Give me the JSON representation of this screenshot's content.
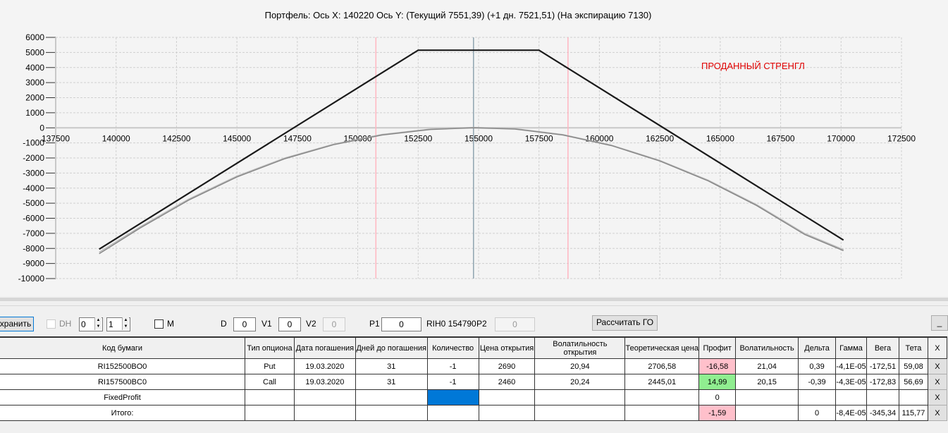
{
  "chart_data": {
    "type": "line",
    "title": "Портфель: Ось X: 140220 Ось Y:  (Текущий 7551,39)  (+1 дн. 7521,51)  (На экспирацию 7130)",
    "annotation": "ПРОДАННЫЙ СТРЕНГЛ",
    "xlim": [
      137500,
      172500
    ],
    "ylim": [
      -10000,
      6000
    ],
    "x_ticks": [
      "137500",
      "140000",
      "142500",
      "145000",
      "147500",
      "150000",
      "152500",
      "155000",
      "157500",
      "160000",
      "162500",
      "165000",
      "167500",
      "170000",
      "172500"
    ],
    "y_ticks": [
      "6000",
      "5000",
      "4000",
      "3000",
      "2000",
      "1000",
      "0",
      "-1000",
      "-2000",
      "-3000",
      "-4000",
      "-5000",
      "-6000",
      "-7000",
      "-8000",
      "-9000",
      "-10000"
    ],
    "vertical_markers": [
      {
        "x": 150750,
        "color": "#ffb6c1"
      },
      {
        "x": 154790,
        "color": "#8fa3b0"
      },
      {
        "x": 158700,
        "color": "#ffb6c1"
      }
    ],
    "series": [
      {
        "name": "На экспирацию",
        "color": "#1a1a1a",
        "points": [
          [
            139300,
            -8050
          ],
          [
            152500,
            5150
          ],
          [
            157500,
            5150
          ],
          [
            170100,
            -7450
          ]
        ]
      },
      {
        "name": "Текущий",
        "color": "#888888",
        "points": [
          [
            139300,
            -8350
          ],
          [
            141000,
            -6640
          ],
          [
            143000,
            -4800
          ],
          [
            145000,
            -3260
          ],
          [
            147000,
            -2040
          ],
          [
            149000,
            -1120
          ],
          [
            151000,
            -480
          ],
          [
            153000,
            -110
          ],
          [
            154800,
            0
          ],
          [
            156500,
            -80
          ],
          [
            158500,
            -480
          ],
          [
            160500,
            -1180
          ],
          [
            162500,
            -2200
          ],
          [
            164500,
            -3520
          ],
          [
            166500,
            -5150
          ],
          [
            168500,
            -7080
          ],
          [
            170100,
            -8150
          ]
        ]
      },
      {
        "name": "+1 дн.",
        "color": "#bbbbbb",
        "points": [
          [
            139300,
            -8250
          ],
          [
            141000,
            -6560
          ],
          [
            143000,
            -4730
          ],
          [
            145000,
            -3200
          ],
          [
            147000,
            -1990
          ],
          [
            149000,
            -1080
          ],
          [
            151000,
            -440
          ],
          [
            153000,
            -80
          ],
          [
            154800,
            30
          ],
          [
            156500,
            -50
          ],
          [
            158500,
            -450
          ],
          [
            160500,
            -1150
          ],
          [
            162500,
            -2160
          ],
          [
            164500,
            -3470
          ],
          [
            166500,
            -5090
          ],
          [
            168500,
            -7010
          ],
          [
            170100,
            -8080
          ]
        ]
      }
    ]
  },
  "toolbar": {
    "save_label": "хранить",
    "dh_label": "DH",
    "spin1": "0",
    "spin2": "1",
    "m_label": "M",
    "d_label": "D",
    "d_value": "0",
    "v1_label": "V1",
    "v1_value": "0",
    "v2_label": "V2",
    "v2_value": "0",
    "p1_label": "P1",
    "p1_value": "0",
    "instrument": "RIH0 154790",
    "p2_label": "P2",
    "p2_value": "0",
    "calc_label": "Рассчитать ГО",
    "min_label": "_"
  },
  "table": {
    "headers": [
      "Код бумаги",
      "Тип опциона",
      "Дата погашения",
      "Дней до погашения",
      "Количество",
      "Цена открытия",
      "Волатильность открытия",
      "Теоретическая цена",
      "Профит",
      "Волатильность",
      "Дельта",
      "Гамма",
      "Вега",
      "Тета",
      "X"
    ],
    "rows": [
      [
        "RI152500BO0",
        "Put",
        "19.03.2020",
        "31",
        "-1",
        "2690",
        "20,94",
        "2706,58",
        "-16,58",
        "21,04",
        "0,39",
        "-4,1E-05",
        "-172,51",
        "59,08",
        "X"
      ],
      [
        "RI157500BC0",
        "Call",
        "19.03.2020",
        "31",
        "-1",
        "2460",
        "20,24",
        "2445,01",
        "14,99",
        "20,15",
        "-0,39",
        "-4,3E-05",
        "-172,83",
        "56,69",
        "X"
      ],
      [
        "FixedProfit",
        "",
        "",
        "",
        "",
        "",
        "",
        "",
        "0",
        "",
        "",
        "",
        "",
        "",
        "X"
      ],
      [
        "Итого:",
        "",
        "",
        "",
        "",
        "",
        "",
        "",
        "-1,59",
        "",
        "0",
        "-8,4E-05",
        "-345,34",
        "115,77",
        "X"
      ]
    ]
  }
}
